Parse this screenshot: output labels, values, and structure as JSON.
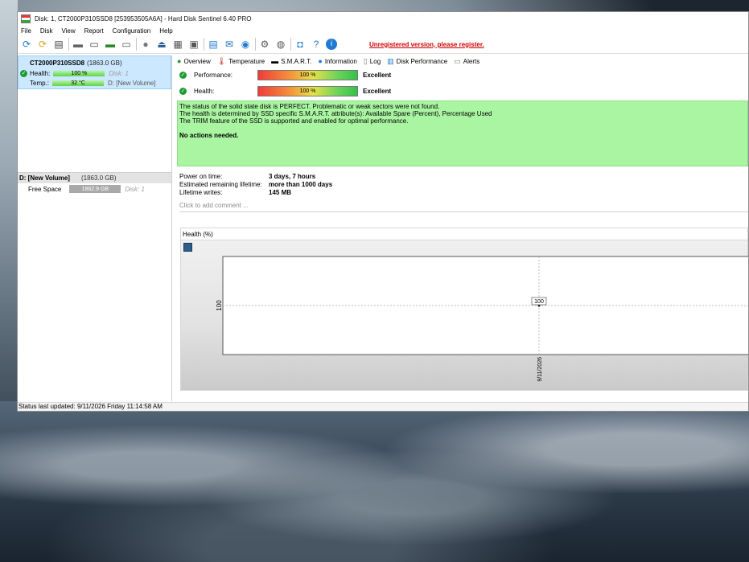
{
  "window": {
    "title": "Disk: 1, CT2000P310SSD8 [253953505A6A]  -  Hard Disk Sentinel 6.40 PRO"
  },
  "menu": [
    "File",
    "Disk",
    "View",
    "Report",
    "Configuration",
    "Help"
  ],
  "toolbar": {
    "icons": [
      "refresh-icon",
      "refresh-all-icon",
      "disk-list-icon",
      "disk-gray-icon",
      "disk-info-icon",
      "disk-check-icon",
      "disk-settings-icon",
      "drive-icon",
      "eject-icon",
      "server-icon",
      "copy-disk-icon",
      "notes-icon",
      "mail-icon",
      "globe-icon",
      "gear-icon",
      "tools-icon",
      "camera-icon",
      "help-icon",
      "info-icon"
    ],
    "unregistered": "Unregistered version, please register."
  },
  "left": {
    "disk_name": "CT2000P310SSD8",
    "disk_size": "(1863.0 GB)",
    "health_label": "Health:",
    "health_value": "100 %",
    "disk_ref": "Disk: 1",
    "temp_label": "Temp.:",
    "temp_value": "32 °C",
    "volume_ref": "D: [New Volume]",
    "volume_name": "D: [New Volume]",
    "volume_size": "(1863.0 GB)",
    "free_label": "Free Space",
    "free_value": "1862.9 GB",
    "free_disk": "Disk: 1"
  },
  "tabs": [
    {
      "label": "Overview",
      "icon": "check-icon"
    },
    {
      "label": "Temperature",
      "icon": "thermometer-icon"
    },
    {
      "label": "S.M.A.R.T.",
      "icon": "smart-icon"
    },
    {
      "label": "Information",
      "icon": "info-icon"
    },
    {
      "label": "Log",
      "icon": "log-icon"
    },
    {
      "label": "Disk Performance",
      "icon": "performance-icon"
    },
    {
      "label": "Alerts",
      "icon": "alerts-icon"
    }
  ],
  "overview": {
    "performance_label": "Performance:",
    "performance_value": "100 %",
    "performance_rating": "Excellent",
    "health_label": "Health:",
    "health_value": "100 %",
    "health_rating": "Excellent",
    "status_lines": [
      "The status of the solid state disk is PERFECT. Problematic or weak sectors were not found.",
      "The health is determined by SSD specific S.M.A.R.T. attribute(s):  Available Spare (Percent), Percentage Used",
      "The TRIM feature of the SSD is supported and enabled for optimal performance."
    ],
    "actions": "No actions needed.",
    "info": [
      {
        "k": "Power on time:",
        "v": "3 days, 7 hours"
      },
      {
        "k": "Estimated remaining lifetime:",
        "v": "more than 1000 days"
      },
      {
        "k": "Lifetime writes:",
        "v": "145 MB"
      }
    ],
    "comment_placeholder": "Click to add comment ..."
  },
  "chart_title": "Health (%)",
  "chart_data": {
    "type": "line",
    "x": [
      "9/11/2026"
    ],
    "series": [
      {
        "values": [
          100
        ]
      }
    ],
    "ylabel": "",
    "yticks": [
      "100"
    ],
    "data_labels": [
      "100"
    ],
    "grid": true
  },
  "status_bar": "Status last updated: 9/11/2026 Friday 11:14:58 AM"
}
